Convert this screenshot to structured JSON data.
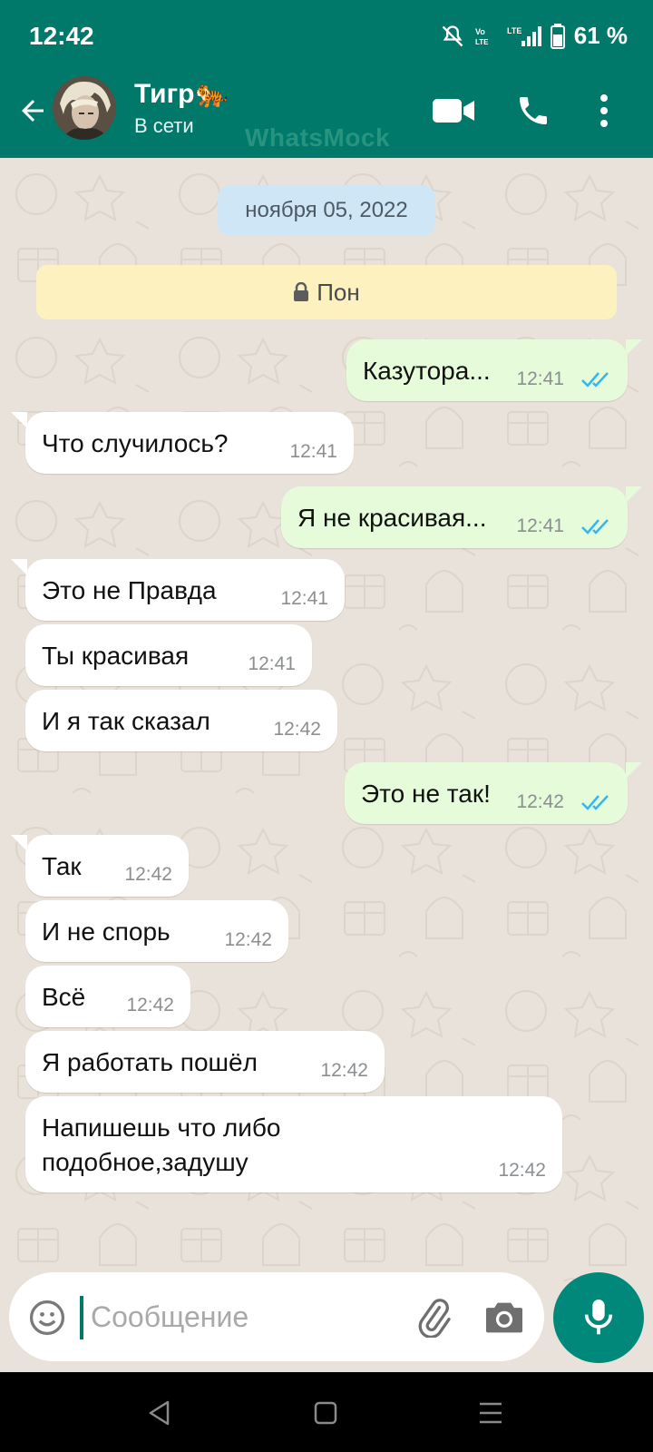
{
  "status_bar": {
    "time": "12:42",
    "battery": "61 %"
  },
  "header": {
    "contact_name": "Тигр🐅",
    "contact_status": "В сети",
    "watermark": "WhatsMock"
  },
  "chat": {
    "date": "ноября 05, 2022",
    "notice": "Пон",
    "messages": [
      {
        "dir": "out",
        "text": "Казутора...",
        "time": "12:41"
      },
      {
        "dir": "in",
        "text": "Что случилось?",
        "time": "12:41"
      },
      {
        "dir": "out",
        "text": "Я не красивая...",
        "time": "12:41"
      },
      {
        "dir": "in",
        "text": "Это не Правда",
        "time": "12:41"
      },
      {
        "dir": "in",
        "text": "Ты красивая",
        "time": "12:41"
      },
      {
        "dir": "in",
        "text": "И я так сказал",
        "time": "12:42"
      },
      {
        "dir": "out",
        "text": "Это не так!",
        "time": "12:42"
      },
      {
        "dir": "in",
        "text": "Так",
        "time": "12:42"
      },
      {
        "dir": "in",
        "text": "И не спорь",
        "time": "12:42"
      },
      {
        "dir": "in",
        "text": "Всё",
        "time": "12:42"
      },
      {
        "dir": "in",
        "text": "Я работать пошёл",
        "time": "12:42"
      },
      {
        "dir": "in",
        "text": "Напишешь что либо подобное,задушу",
        "time": "12:42"
      }
    ]
  },
  "compose": {
    "placeholder": "Сообщение",
    "value": ""
  },
  "colors": {
    "header": "#00796b",
    "outgoing_bubble": "#e6fbd9",
    "incoming_bubble": "#ffffff",
    "ticks": "#34b7f1",
    "mic_button": "#00897b"
  },
  "icons": [
    "back-arrow-icon",
    "video-call-icon",
    "phone-icon",
    "more-options-icon",
    "lock-icon",
    "double-check-icon",
    "emoji-icon",
    "paperclip-icon",
    "camera-icon",
    "mic-icon"
  ]
}
